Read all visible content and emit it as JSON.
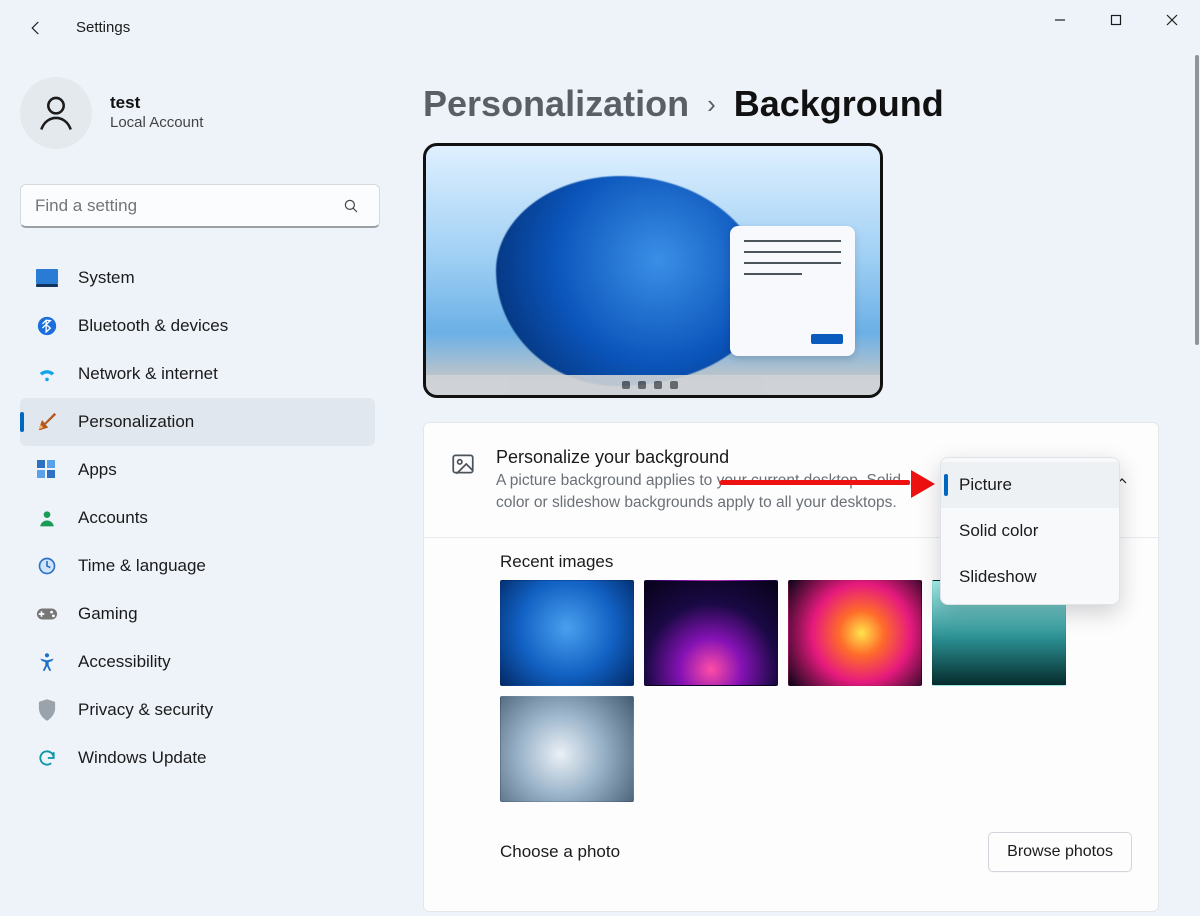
{
  "titlebar": {
    "app_title": "Settings"
  },
  "sidebar": {
    "account": {
      "name": "test",
      "subtitle": "Local Account"
    },
    "search": {
      "placeholder": "Find a setting"
    },
    "items": [
      {
        "icon": "system-icon",
        "label": "System"
      },
      {
        "icon": "bluetooth-icon",
        "label": "Bluetooth & devices"
      },
      {
        "icon": "network-icon",
        "label": "Network & internet"
      },
      {
        "icon": "personalization-icon",
        "label": "Personalization",
        "active": true
      },
      {
        "icon": "apps-icon",
        "label": "Apps"
      },
      {
        "icon": "accounts-icon",
        "label": "Accounts"
      },
      {
        "icon": "time-lang-icon",
        "label": "Time & language"
      },
      {
        "icon": "gaming-icon",
        "label": "Gaming"
      },
      {
        "icon": "accessibility-icon",
        "label": "Accessibility"
      },
      {
        "icon": "privacy-icon",
        "label": "Privacy & security"
      },
      {
        "icon": "update-icon",
        "label": "Windows Update"
      }
    ]
  },
  "breadcrumb": {
    "parent": "Personalization",
    "current": "Background"
  },
  "main": {
    "personalize": {
      "title": "Personalize your background",
      "description": "A picture background applies to your current desktop. Solid color or slideshow backgrounds apply to all your desktops.",
      "selected": "Picture",
      "options": [
        "Picture",
        "Solid color",
        "Slideshow"
      ]
    },
    "recent_images_label": "Recent images",
    "choose_photo_label": "Choose a photo",
    "browse_button": "Browse photos"
  },
  "colors": {
    "accent": "#0067c0",
    "annotation": "#e11"
  }
}
